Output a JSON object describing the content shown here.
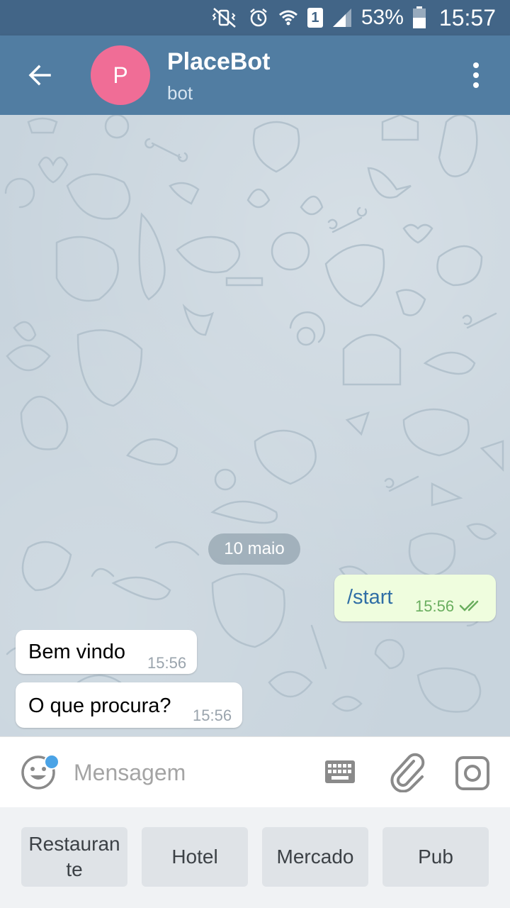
{
  "status_bar": {
    "battery_percent": "53%",
    "time": "15:57",
    "sim_label": "1",
    "icons": [
      "mute-vibrate-icon",
      "alarm-icon",
      "wifi-icon",
      "sim-icon",
      "signal-icon",
      "battery-icon"
    ]
  },
  "header": {
    "title": "PlaceBot",
    "subtitle": "bot",
    "avatar_letter": "P",
    "avatar_color": "#f06d96",
    "bar_color": "#517da2"
  },
  "chat": {
    "date_separator": "10 maio",
    "messages": [
      {
        "direction": "outgoing",
        "text": "/start",
        "time": "15:56",
        "status": "read"
      },
      {
        "direction": "incoming",
        "text": "Bem vindo",
        "time": "15:56"
      },
      {
        "direction": "incoming",
        "text": "O que procura?",
        "time": "15:56"
      }
    ]
  },
  "input": {
    "placeholder": "Mensagem",
    "value": ""
  },
  "bot_keyboard": {
    "buttons": [
      "Restaurante",
      "Hotel",
      "Mercado",
      "Pub"
    ]
  }
}
